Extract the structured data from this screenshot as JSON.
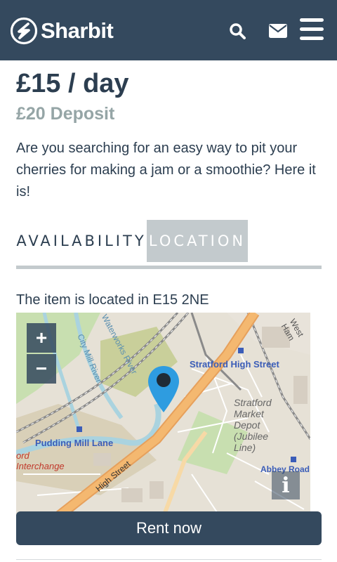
{
  "header": {
    "brand": "Sharbit",
    "background": "#34495e",
    "icons": [
      "logo-icon",
      "search-icon",
      "envelope-icon",
      "hamburger-menu-icon"
    ]
  },
  "item": {
    "price": "£15 / day",
    "deposit": "£20 Deposit",
    "description": "Are you searching for an easy way to pit your cherries for making a jam or a smoothie? Here it is!"
  },
  "tabs": [
    {
      "label": "AVAILABILITY",
      "active": false
    },
    {
      "label": "LOCATION",
      "active": true
    }
  ],
  "location": {
    "text": "The item is located in E15 2NE"
  },
  "map": {
    "zoom_in": "+",
    "zoom_out": "−",
    "info": "i",
    "labels": {
      "stratford_high_street": "Stratford High Street",
      "stratford_market_depot": "Stratford Market Depot (Jubilee Line)",
      "pudding_mill_lane": "Pudding Mill Lane",
      "interchange": "Interchange",
      "ord": "ord",
      "high_street": "High Street",
      "city_mill_river": "City Mill River",
      "waterworks_river": "Waterworks River",
      "west_ham": "West Ham",
      "abbey_road": "Abbey Road"
    }
  },
  "actions": {
    "rent_label": "Rent now"
  },
  "colors": {
    "primary": "#34495e",
    "muted": "#95a5a6",
    "tab_active_bg": "#c3cacd",
    "map_road_major": "#f4b870",
    "map_water": "#aad3df",
    "map_park": "#c8dfb0",
    "label_blue": "#3b5db8",
    "label_red": "#c0392b"
  }
}
